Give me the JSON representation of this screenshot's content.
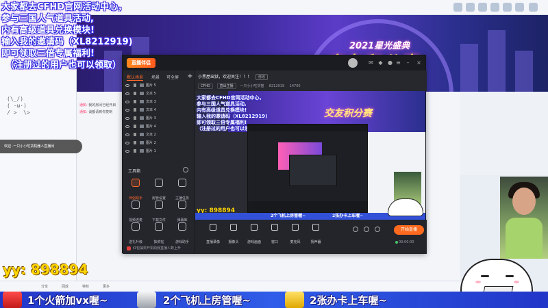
{
  "promo_overlay": {
    "lines": [
      "大家都去CFHD官网活动中心，",
      "参与三国人气道具活动,",
      "内有高级道具兑换模块!",
      "输入我的邀请码（XL8212919)",
      "即可领取三倍专属福利!",
      "（注册过的用户也可以领取）"
    ]
  },
  "banner": {
    "subtitle": "2021星光盛典",
    "title": "交友积分赛"
  },
  "kaomoji": "(\\_/)\n( ·ω·)\n/ >  \\>",
  "chat": {
    "notices": [
      {
        "prefix": "通知:",
        "text": "我的房间已经开启"
      },
      {
        "prefix": "通知:",
        "text": "谈都请到你复制"
      }
    ],
    "welcome": {
      "prefix": "欢迎",
      "name": "·",
      "suffix": "·一只小小吃货机器人直播间"
    }
  },
  "app": {
    "logo_text": "直播伴侣",
    "tabs": [
      "默认场景",
      "场景",
      "可全屏"
    ],
    "add_scene": "+",
    "sources": [
      {
        "label": "图片 5"
      },
      {
        "label": "文本 5"
      },
      {
        "label": "文本 3"
      },
      {
        "label": "文本 4"
      },
      {
        "label": "图片 3"
      },
      {
        "label": "图片 4"
      },
      {
        "label": "文本 2"
      },
      {
        "label": "图片 2"
      },
      {
        "label": "图片 1"
      }
    ],
    "tools_heading": "工具箱",
    "tools": [
      {
        "label": "伴侣助手",
        "icon": "screen-icon",
        "hot": true
      },
      {
        "label": "房管设置",
        "icon": "user-icon",
        "hot": false
      },
      {
        "label": "主播任务",
        "icon": "headset-icon",
        "hot": false
      },
      {
        "label": "视频连麦",
        "icon": "video-icon",
        "hot": false
      },
      {
        "label": "下载文件",
        "icon": "download-icon",
        "hot": false
      },
      {
        "label": "弹幕库",
        "icon": "list-icon",
        "hot": false
      },
      {
        "label": "送礼升级",
        "icon": "gift-icon",
        "hot": false
      },
      {
        "label": "抽奖帖",
        "icon": "gift-box-icon",
        "hot": false
      },
      {
        "label": "游戏助手",
        "icon": "game-icon",
        "hot": false
      }
    ],
    "bottom_tip": "红包抽奖开机助我直播人数上升",
    "room_title": "小黑屋出狱，欢迎关注！！！",
    "room_mod": "修改",
    "room_chips": [
      "CFHD",
      "直出主播",
      "一只小小吃货猫"
    ],
    "room_id": "8212919",
    "viewers": "14700",
    "bottom_buttons": [
      {
        "label": "直播录像",
        "icon": "record-icon"
      },
      {
        "label": "摄像头",
        "icon": "camera-icon"
      },
      {
        "label": "游戏画面",
        "icon": "gamepad-icon"
      },
      {
        "label": "窗口",
        "icon": "window-icon"
      },
      {
        "label": "麦克风",
        "icon": "mic-icon"
      },
      {
        "label": "扬声器",
        "icon": "speaker-icon"
      }
    ],
    "go_live": "开始直播",
    "timer": "00:00:00"
  },
  "preview": {
    "yy": "yy: 898894",
    "ticker": [
      "2个飞机上房管喔~",
      "2张办卡上车喔~"
    ]
  },
  "yy_big": "yy:  898894",
  "ticker": [
    {
      "text": "1个火箭加vx喔~",
      "gift": "rocket"
    },
    {
      "text": "2个飞机上房管喔~",
      "gift": "plane"
    },
    {
      "text": "2张办卡上车喔~",
      "gift": "card"
    }
  ],
  "bottom_bar": [
    "分享",
    "回放",
    "特权",
    "更多"
  ]
}
